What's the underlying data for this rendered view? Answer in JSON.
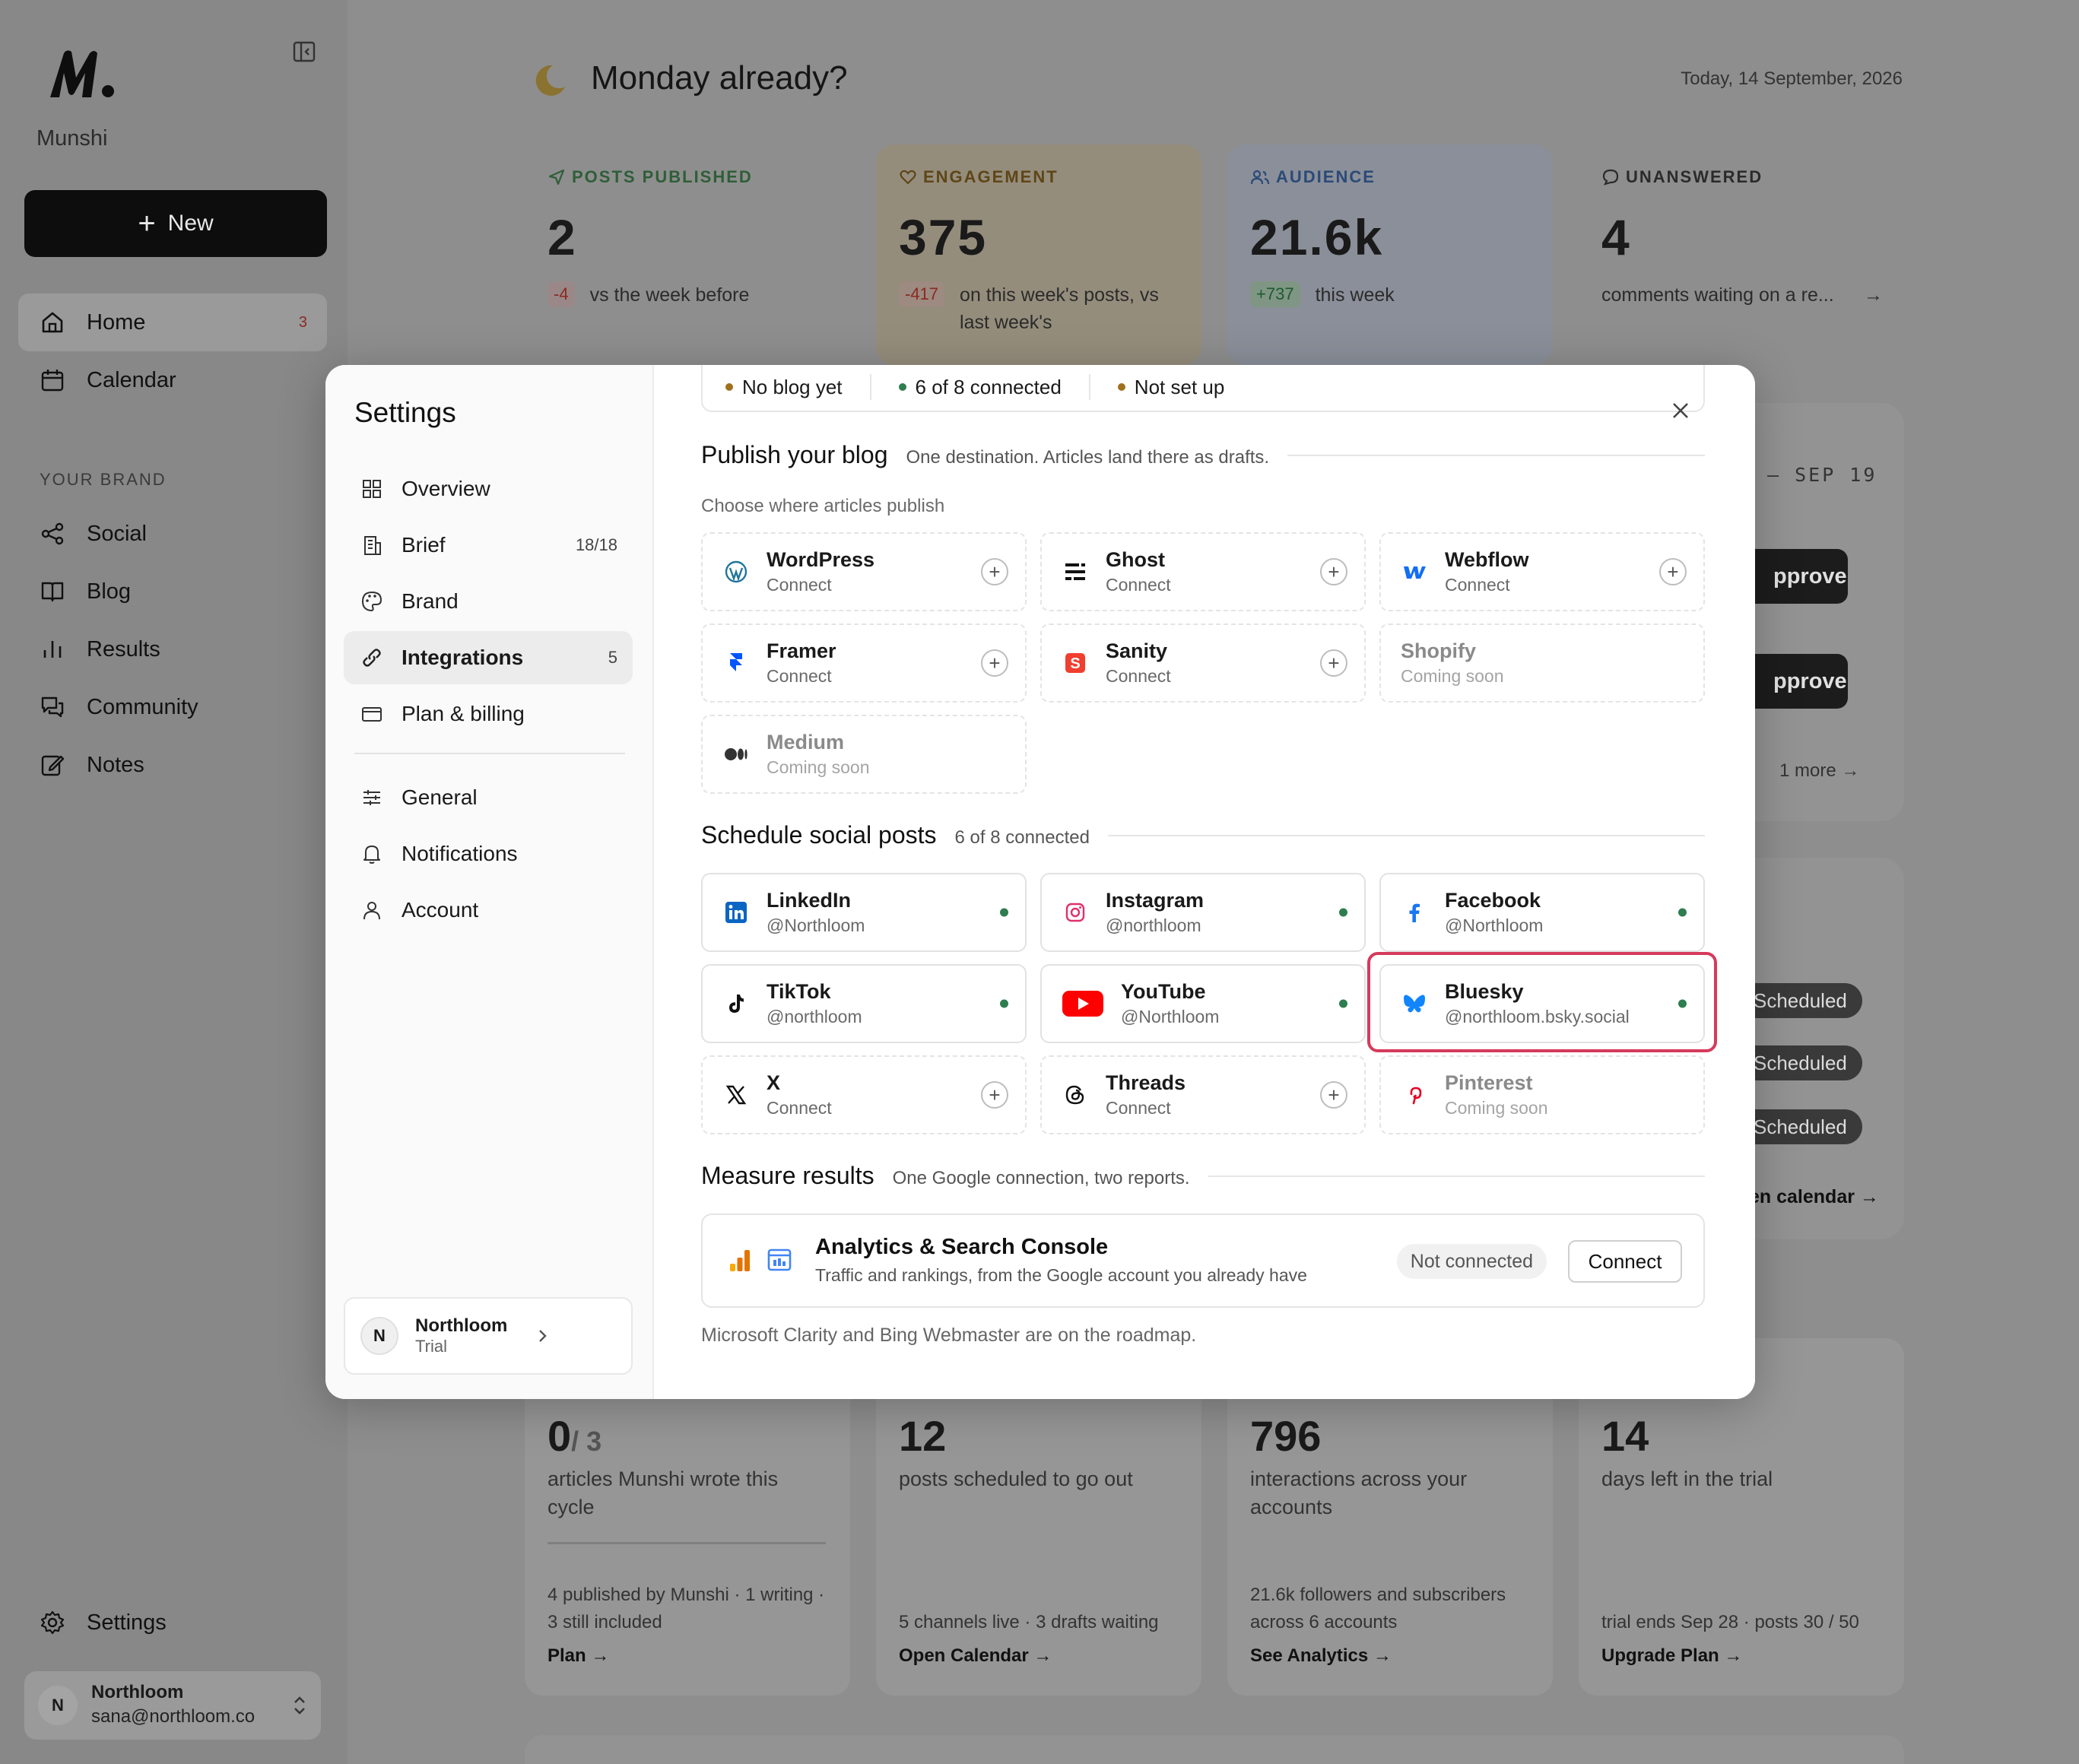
{
  "app": {
    "name": "Munshi",
    "new_label": "New",
    "nav": [
      {
        "label": "Home",
        "badge": "3"
      },
      {
        "label": "Calendar"
      }
    ],
    "brand_section": "YOUR BRAND",
    "brand_nav": [
      "Social",
      "Blog",
      "Results",
      "Community",
      "Notes"
    ],
    "settings_label": "Settings",
    "user": {
      "initial": "N",
      "name": "Northloom",
      "email": "sana@northloom.co"
    }
  },
  "dashboard": {
    "greeting": "Monday already?",
    "date": "Today, 14 September, 2026",
    "stats": [
      {
        "label": "POSTS PUBLISHED",
        "value": "2",
        "delta": "-4",
        "sub": "vs the week before",
        "color": "#2f6b3a",
        "bg": "#8e8e8e"
      },
      {
        "label": "ENGAGEMENT",
        "value": "375",
        "delta": "-417",
        "sub": "on this week's posts, vs last week's",
        "color": "#6b4e12",
        "bg": "#958d7c"
      },
      {
        "label": "AUDIENCE",
        "value": "21.6k",
        "delta": "+737",
        "sub": "this week",
        "color": "#2b4a78",
        "bg": "#8a8f99"
      },
      {
        "label": "UNANSWERED",
        "value": "4",
        "delta": "",
        "sub": "comments waiting on a re...",
        "color": "#333333",
        "bg": "#8e8e8e"
      }
    ],
    "week_range": "– SEP 19",
    "approve_label": "pprove",
    "more_label": "1 more",
    "scheduled_label": "Scheduled",
    "calendar_link": "en calendar →",
    "bottom": [
      {
        "value": "0",
        "denom": "/ 3",
        "sub": "articles Munshi wrote this cycle",
        "foot": "4 published by Munshi · 1 writing · 3 still included",
        "link": "Plan →"
      },
      {
        "value": "12",
        "denom": "",
        "sub": "posts scheduled to go out",
        "foot": "5 channels live · 3 drafts waiting",
        "link": "Open Calendar →"
      },
      {
        "value": "796",
        "denom": "",
        "sub": "interactions across your accounts",
        "foot": "21.6k followers and subscribers across 6 accounts",
        "link": "See Analytics →"
      },
      {
        "value": "14",
        "denom": "",
        "sub": "days left in the trial",
        "foot": "trial ends Sep 28 · posts 30 / 50",
        "link": "Upgrade Plan →"
      }
    ]
  },
  "settings": {
    "title": "Settings",
    "nav": [
      {
        "label": "Overview",
        "icon": "grid-icon"
      },
      {
        "label": "Brief",
        "icon": "building-icon",
        "count": "18/18"
      },
      {
        "label": "Brand",
        "icon": "palette-icon"
      },
      {
        "label": "Integrations",
        "icon": "link-icon",
        "count": "5"
      },
      {
        "label": "Plan & billing",
        "icon": "card-icon"
      }
    ],
    "nav2": [
      {
        "label": "General",
        "icon": "sliders-icon"
      },
      {
        "label": "Notifications",
        "icon": "bell-icon"
      },
      {
        "label": "Account",
        "icon": "user-icon"
      }
    ],
    "workspace": {
      "initial": "N",
      "name": "Northloom",
      "plan": "Trial"
    },
    "status": [
      {
        "label": "No blog yet",
        "color": "#a0701c"
      },
      {
        "label": "6 of 8 connected",
        "color": "#2e7d4f"
      },
      {
        "label": "Not set up",
        "color": "#a0701c"
      }
    ],
    "blog": {
      "title": "Publish your blog",
      "subtitle": "One destination. Articles land there as drafts.",
      "hint": "Choose where articles publish",
      "items": [
        {
          "name": "WordPress",
          "sub": "Connect",
          "icon": "wordpress-icon",
          "state": "add"
        },
        {
          "name": "Ghost",
          "sub": "Connect",
          "icon": "ghost-icon",
          "state": "add"
        },
        {
          "name": "Webflow",
          "sub": "Connect",
          "icon": "webflow-icon",
          "state": "add"
        },
        {
          "name": "Framer",
          "sub": "Connect",
          "icon": "framer-icon",
          "state": "add"
        },
        {
          "name": "Sanity",
          "sub": "Connect",
          "icon": "sanity-icon",
          "state": "add"
        },
        {
          "name": "Shopify",
          "sub": "Coming soon",
          "icon": "",
          "state": "soon"
        },
        {
          "name": "Medium",
          "sub": "Coming soon",
          "icon": "medium-icon",
          "state": "soon"
        }
      ]
    },
    "social": {
      "title": "Schedule social posts",
      "subtitle": "6 of 8 connected",
      "items": [
        {
          "name": "LinkedIn",
          "sub": "@Northloom",
          "icon": "linkedin-icon",
          "state": "connected"
        },
        {
          "name": "Instagram",
          "sub": "@northloom",
          "icon": "instagram-icon",
          "state": "connected"
        },
        {
          "name": "Facebook",
          "sub": "@Northloom",
          "icon": "facebook-icon",
          "state": "connected"
        },
        {
          "name": "TikTok",
          "sub": "@northloom",
          "icon": "tiktok-icon",
          "state": "connected"
        },
        {
          "name": "YouTube",
          "sub": "@Northloom",
          "icon": "youtube-icon",
          "state": "connected"
        },
        {
          "name": "Bluesky",
          "sub": "@northloom.bsky.social",
          "icon": "bluesky-icon",
          "state": "connected"
        },
        {
          "name": "X",
          "sub": "Connect",
          "icon": "x-icon",
          "state": "add"
        },
        {
          "name": "Threads",
          "sub": "Connect",
          "icon": "threads-icon",
          "state": "add"
        },
        {
          "name": "Pinterest",
          "sub": "Coming soon",
          "icon": "pinterest-icon",
          "state": "soon"
        }
      ]
    },
    "measure": {
      "title": "Measure results",
      "subtitle": "One Google connection, two reports.",
      "card_title": "Analytics & Search Console",
      "card_sub": "Traffic and rankings, from the Google account you already have",
      "status": "Not connected",
      "button": "Connect",
      "roadmap": "Microsoft Clarity and Bing Webmaster are on the roadmap."
    }
  }
}
